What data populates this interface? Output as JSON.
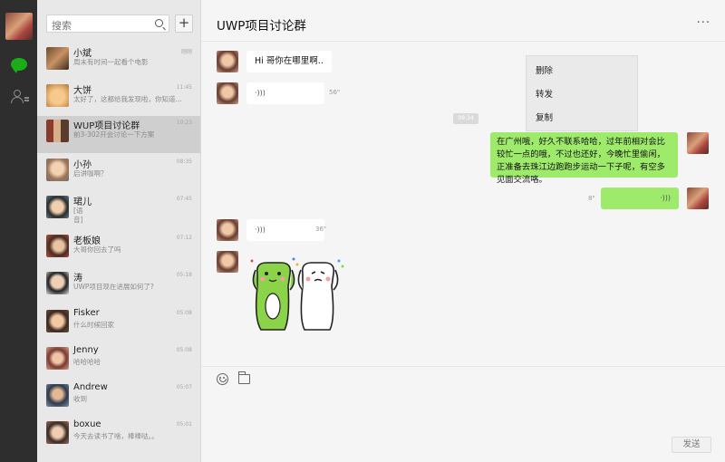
{
  "sidebar": {
    "nav": [
      {
        "name": "chat-icon"
      },
      {
        "name": "contacts-icon"
      }
    ]
  },
  "search": {
    "placeholder": "搜索"
  },
  "add_label": "+",
  "conversations": [
    {
      "name": "小斌",
      "preview": "周末有时间一起看个电影",
      "time": "刚刚"
    },
    {
      "name": "大饼",
      "preview": "太好了，这都给我发现啦，你知道...",
      "time": "11:45"
    },
    {
      "name": "WUP项目讨论群",
      "preview": "前3-302开会讨论一下方案",
      "time": "10:23"
    },
    {
      "name": "小孙",
      "preview": "启讲咖啊？",
      "time": "08:35"
    },
    {
      "name": "珺儿",
      "preview": "[语\n音]",
      "time": "07:45"
    },
    {
      "name": "老板娘",
      "preview": "大哥你回去了吗",
      "time": "07:12"
    },
    {
      "name": "涛",
      "preview": "UWP项目现在进展如何了?",
      "time": "05:18"
    },
    {
      "name": "Fisker",
      "preview": "什么时候回家",
      "time": "05:08"
    },
    {
      "name": "Jenny",
      "preview": "哈哈哈哈",
      "time": "05:08"
    },
    {
      "name": "Andrew",
      "preview": "收到",
      "time": "05:07"
    },
    {
      "name": "boxue",
      "preview": "今天去读书了啥，棒棒哒。。",
      "time": "05:01"
    }
  ],
  "chat": {
    "title": "UWP项目讨论群",
    "more": "···",
    "messages": [
      {
        "text": "Hi 哥你在哪里啊.."
      },
      {
        "voice": "·)))",
        "duration": "56\""
      },
      {
        "timestamp": "09:34"
      },
      {
        "text": "在广州哦，好久不联系哈哈，过年前相对会比较忙一点的哦，不过也还好，今晚忙里偷闲，正准备去珠江边跑跑步运动一下子呢，有空多见面交流咯。"
      },
      {
        "voice": "·)))",
        "duration": "8\""
      },
      {
        "voice": "·)))",
        "duration": "36\""
      }
    ],
    "context_menu": [
      "删除",
      "转发",
      "复制"
    ],
    "send_label": "发送"
  },
  "colors": {
    "accent": "#1aad19",
    "bubble_self": "#9eea6a"
  }
}
